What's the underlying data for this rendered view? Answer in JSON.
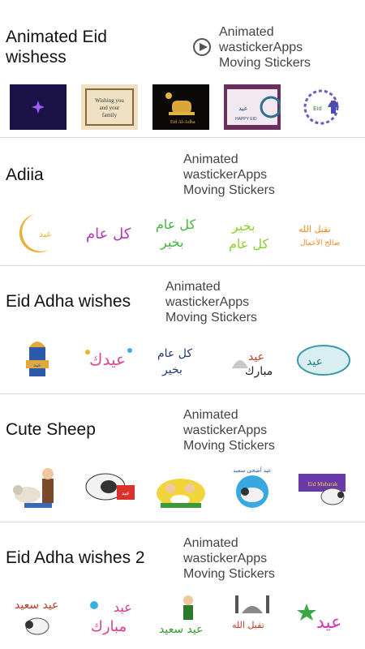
{
  "packs": [
    {
      "title": "Animated Eid\nwishess",
      "subtitle": "Animated\nwastickerApps\nMoving Stickers",
      "has_play_icon": true,
      "stickers": [
        "Wishing you and your family"
      ]
    },
    {
      "title": "Adiia",
      "subtitle": "Animated\nwastickerApps\nMoving Stickers"
    },
    {
      "title": "Eid Adha wishes",
      "subtitle": "Animated\nwastickerApps\nMoving Stickers"
    },
    {
      "title": "Cute Sheep",
      "subtitle": "Animated\nwastickerApps\nMoving Stickers"
    },
    {
      "title": "Eid Adha wishes 2",
      "subtitle": "Animated\nwastickerApps\nMoving Stickers"
    }
  ],
  "colors": {
    "divider": "#d9d9d9",
    "text": "#111111",
    "subtext": "#444444"
  }
}
